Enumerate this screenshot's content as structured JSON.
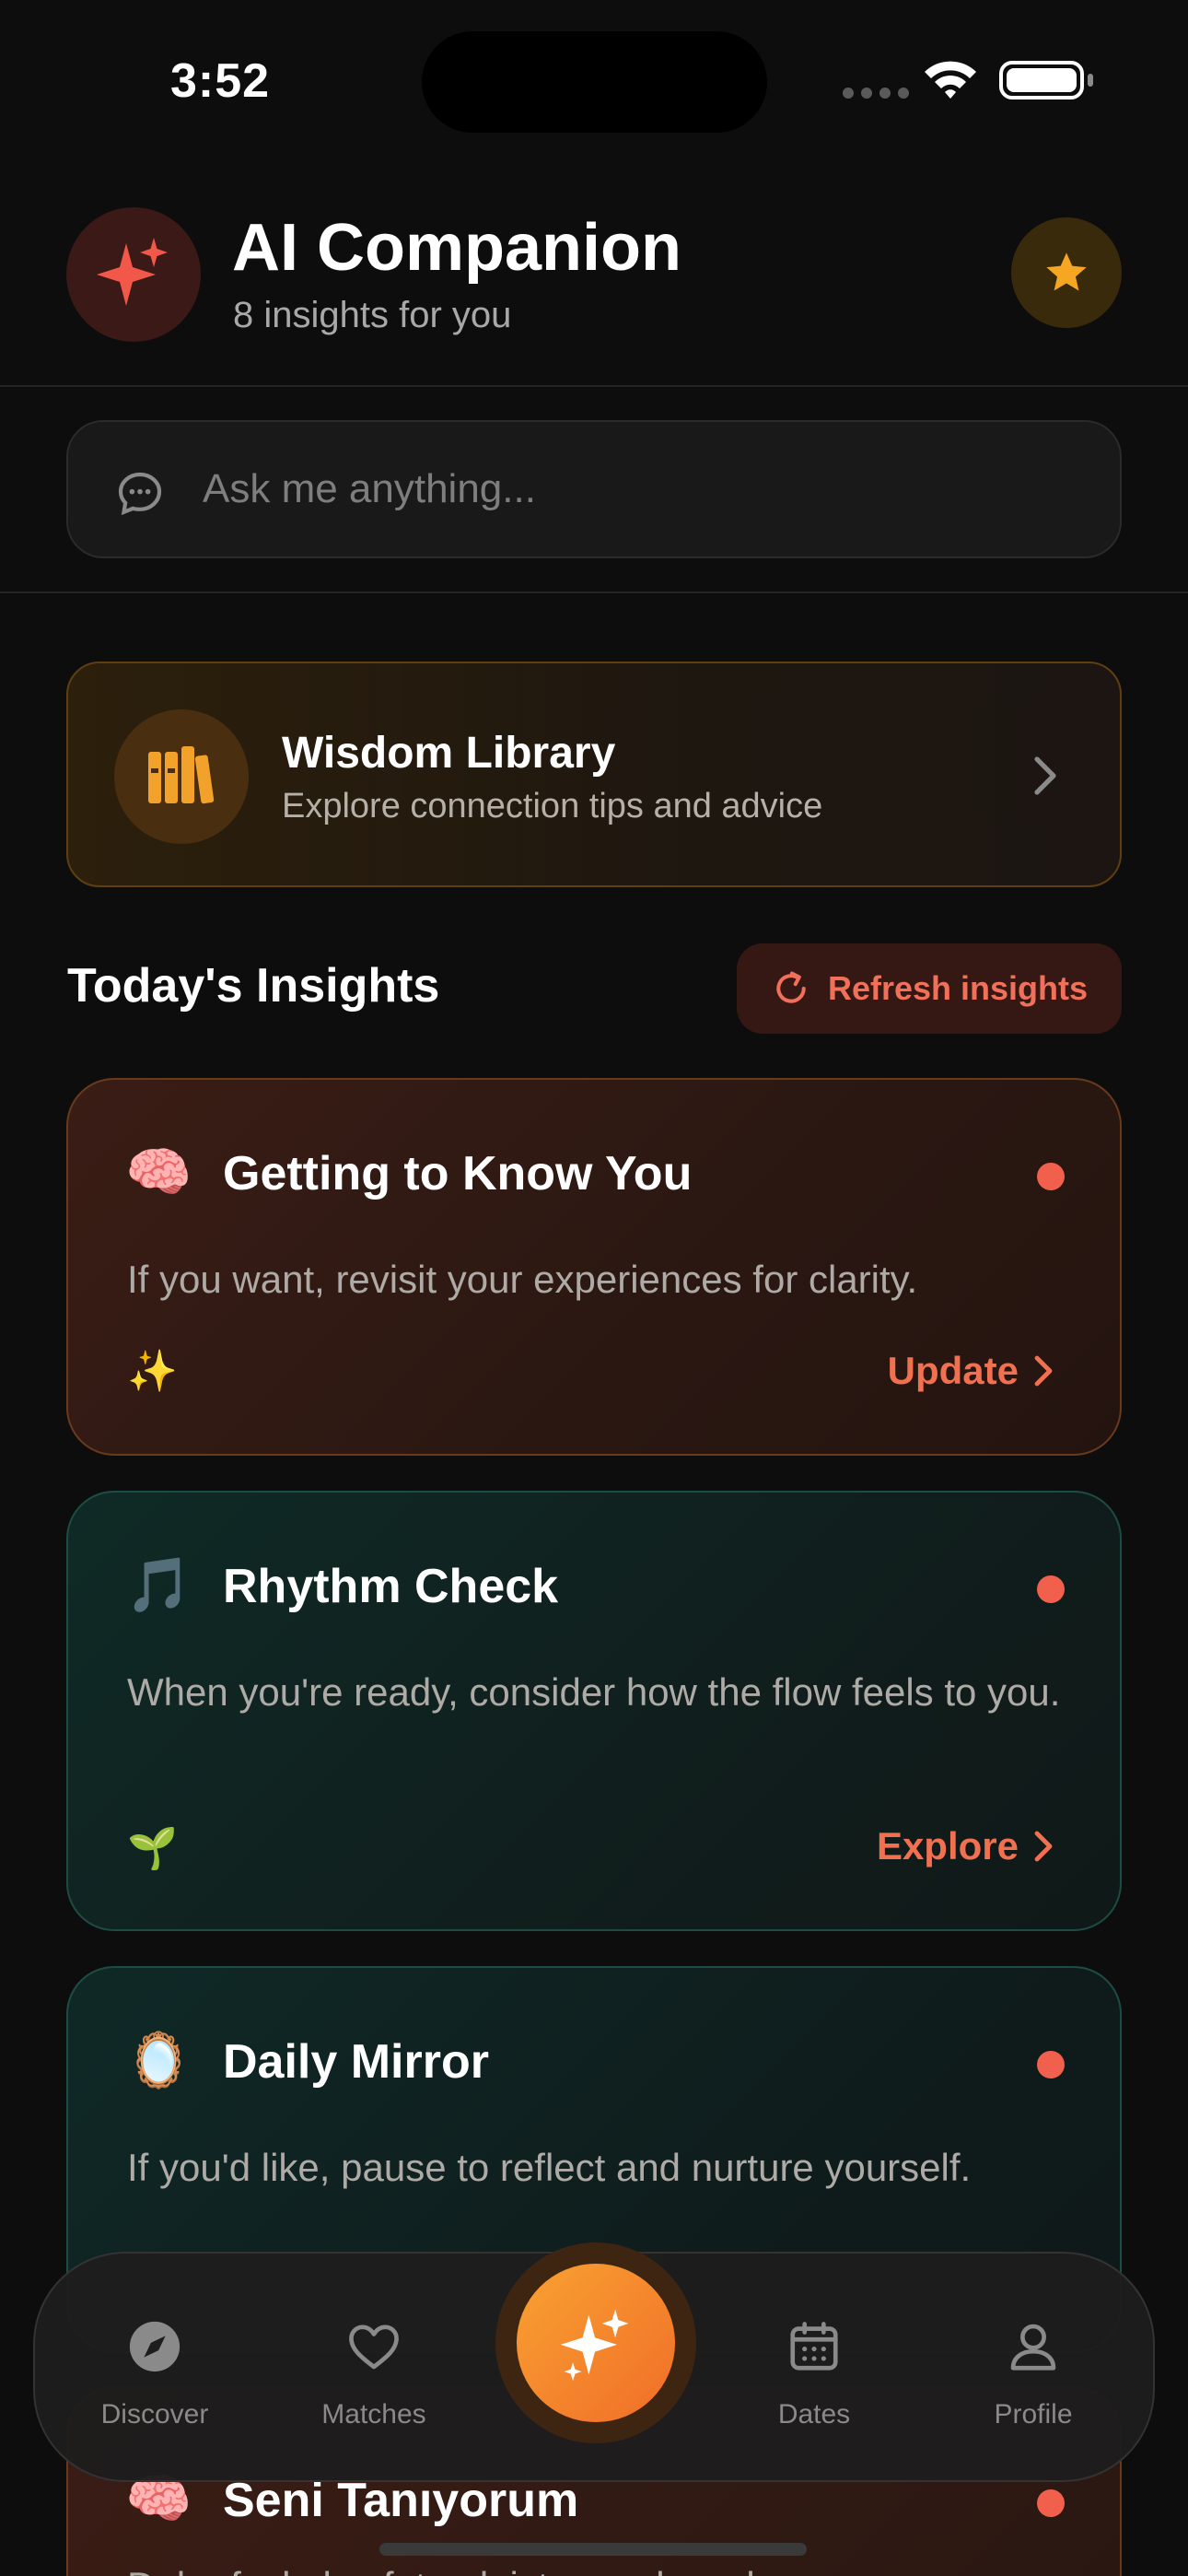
{
  "status_bar": {
    "time": "3:52"
  },
  "header": {
    "title": "AI Companion",
    "subtitle": "8 insights for you",
    "avatar_icon": "sparkles-icon",
    "favorite_icon": "star-icon"
  },
  "search": {
    "placeholder": "Ask me anything...",
    "value": "",
    "icon": "chat-bubble-icon"
  },
  "library": {
    "title": "Wisdom Library",
    "subtitle": "Explore connection tips and advice",
    "icon": "books-icon"
  },
  "insights_section": {
    "title": "Today's Insights",
    "refresh_label": "Refresh insights"
  },
  "cards": [
    {
      "emoji": "🧠",
      "title": "Getting to Know You",
      "body": "If you want, revisit your experiences for clarity.",
      "deco": "✨",
      "action": "Update"
    },
    {
      "emoji": "🎵",
      "title": "Rhythm Check",
      "body": "When you're ready, consider how the flow feels to you.",
      "deco": "🌱",
      "action": "Explore"
    },
    {
      "emoji": "🪞",
      "title": "Daily Mirror",
      "body": "If you'd like, pause to reflect and nurture yourself.",
      "deco": "",
      "action": ""
    },
    {
      "emoji": "🧠",
      "title": "Seni Tanıyorum",
      "body": "Daha fazla keşfetmek istersen buradayım.",
      "deco": "",
      "action": ""
    }
  ],
  "tabbar": {
    "discover": "Discover",
    "matches": "Matches",
    "dates": "Dates",
    "profile": "Profile",
    "center_icon": "sparkles-icon"
  },
  "colors": {
    "accent": "#f0604c",
    "background": "#0d0d0d",
    "library_accent": "#f2a22b",
    "fab_gradient_start": "#f9a232",
    "fab_gradient_end": "#f06d28"
  }
}
